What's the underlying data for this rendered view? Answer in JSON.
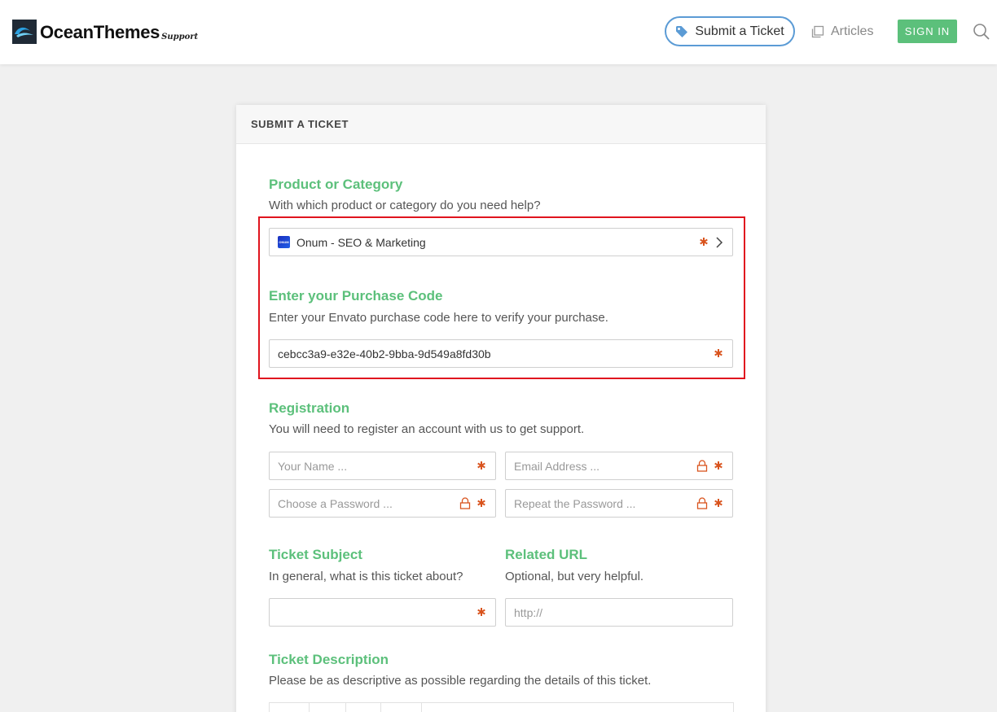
{
  "header": {
    "logo_name": "OceanThemes",
    "logo_sub": "Support",
    "submit_ticket_label": "Submit a Ticket",
    "articles_label": "Articles",
    "signin_label": "SIGN IN",
    "accent_color": "#5cc07b",
    "ticket_border_color": "#5b9bd5"
  },
  "card": {
    "title": "SUBMIT A TICKET"
  },
  "product": {
    "title": "Product or Category",
    "description": "With which product or category do you need help?",
    "selected_value": "Onum - SEO & Marketing",
    "icon_text": "ONUM"
  },
  "purchase": {
    "title": "Enter your Purchase Code",
    "description": "Enter your Envato purchase code here to verify your purchase.",
    "value": "cebcc3a9-e32e-40b2-9bba-9d549a8fd30b"
  },
  "registration": {
    "title": "Registration",
    "description": "You will need to register an account with us to get support.",
    "name_placeholder": "Your Name ...",
    "email_placeholder": "Email Address ...",
    "password_placeholder": "Choose a Password ...",
    "repeat_placeholder": "Repeat the Password ..."
  },
  "subject": {
    "title": "Ticket Subject",
    "description": "In general, what is this ticket about?",
    "value": ""
  },
  "related_url": {
    "title": "Related URL",
    "description": "Optional, but very helpful.",
    "placeholder": "http://"
  },
  "ticket_description": {
    "title": "Ticket Description",
    "description": "Please be as descriptive as possible regarding the details of this ticket."
  },
  "colors": {
    "required_star": "#d9541e",
    "highlight_box": "#e0141e"
  }
}
